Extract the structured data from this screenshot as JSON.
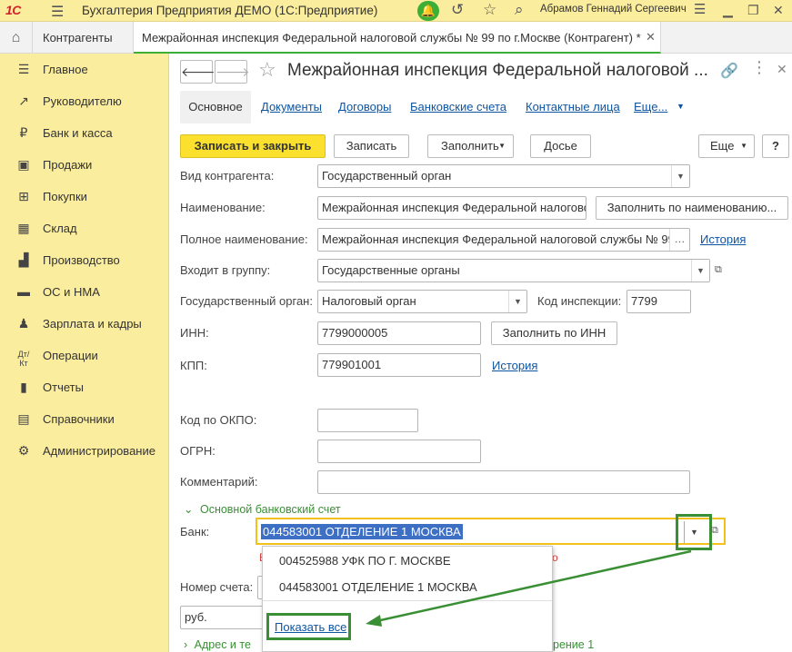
{
  "app": {
    "logo": "1С",
    "title": "Бухгалтерия Предприятия ДЕМО  (1С:Предприятие)",
    "user": "Абрамов Геннадий Сергеевич"
  },
  "tabs": {
    "home_icon": "home-icon",
    "list_tab": "Контрагенты",
    "form_tab": "Межрайонная инспекция Федеральной налоговой службы № 99 по г.Москве (Контрагент) *"
  },
  "sidebar": {
    "items": [
      {
        "label": "Главное",
        "icon": "menu-icon"
      },
      {
        "label": "Руководителю",
        "icon": "trend-icon"
      },
      {
        "label": "Банк и касса",
        "icon": "coin-icon"
      },
      {
        "label": "Продажи",
        "icon": "bag-icon"
      },
      {
        "label": "Покупки",
        "icon": "cart-icon"
      },
      {
        "label": "Склад",
        "icon": "warehouse-icon"
      },
      {
        "label": "Производство",
        "icon": "factory-icon"
      },
      {
        "label": "ОС и НМА",
        "icon": "truck-icon"
      },
      {
        "label": "Зарплата и кадры",
        "icon": "person-icon"
      },
      {
        "label": "Операции",
        "icon": "debit-credit-icon"
      },
      {
        "label": "Отчеты",
        "icon": "bar-chart-icon"
      },
      {
        "label": "Справочники",
        "icon": "book-icon"
      },
      {
        "label": "Администрирование",
        "icon": "gear-icon"
      }
    ]
  },
  "form": {
    "title": "Межрайонная инспекция Федеральной налоговой ...",
    "subtabs": {
      "main": "Основное",
      "documents": "Документы",
      "contracts": "Договоры",
      "bank_accounts": "Банковские счета",
      "contacts": "Контактные лица",
      "more": "Еще..."
    },
    "toolbar": {
      "save_close": "Записать и закрыть",
      "save": "Записать",
      "fill": "Заполнить",
      "dossier": "Досье",
      "more": "Еще",
      "help": "?"
    },
    "fields": {
      "kind_label": "Вид контрагента:",
      "kind_value": "Государственный орган",
      "name_label": "Наименование:",
      "name_value": "Межрайонная инспекция Федеральной налоговой",
      "fill_by_name": "Заполнить по наименованию...",
      "fullname_label": "Полное наименование:",
      "fullname_value": "Межрайонная инспекция Федеральной налоговой службы № 99",
      "history": "История",
      "group_label": "Входит в группу:",
      "group_value": "Государственные органы",
      "gov_label": "Государственный орган:",
      "gov_value": "Налоговый орган",
      "inspection_label": "Код инспекции:",
      "inspection_value": "7799",
      "inn_label": "ИНН:",
      "inn_value": "7799000005",
      "fill_by_inn": "Заполнить по ИНН",
      "kpp_label": "КПП:",
      "kpp_value": "779901001",
      "kpp_history": "История",
      "okpo_label": "Код по ОКПО:",
      "okpo_value": "",
      "ogrn_label": "ОГРН:",
      "ogrn_value": "",
      "comment_label": "Комментарий:",
      "comment_value": ""
    },
    "bank_section": {
      "title": "Основной банковский счет",
      "bank_label": "Банк:",
      "bank_value": "044583001 ОТДЕЛЕНИЕ 1 МОСКВА",
      "account_label": "Номер счета:",
      "currency_value": "руб.",
      "address_section": "Адрес и те",
      "address_section_tail": "рение 1"
    },
    "dropdown": {
      "options": [
        "004525988 УФК ПО Г. МОСКВЕ",
        "044583001 ОТДЕЛЕНИЕ 1 МОСКВА"
      ],
      "show_all": "Показать все"
    }
  }
}
